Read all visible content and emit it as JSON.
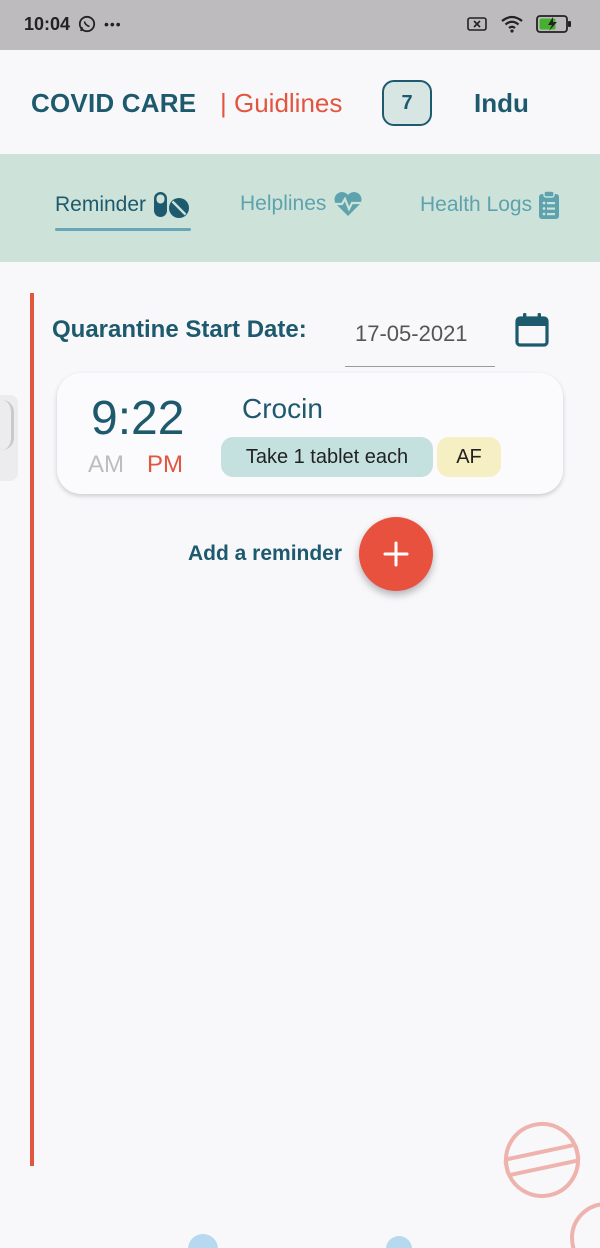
{
  "status_bar": {
    "time": "10:04",
    "dots": "•••",
    "icons": [
      "whatsapp-icon",
      "sim-off-icon",
      "wifi-icon",
      "battery-charging-icon"
    ]
  },
  "header": {
    "app_title": "COVID CARE",
    "guidelines_link": "| Guidlines",
    "badge_count": "7",
    "user_name": "Indu"
  },
  "tabs": [
    {
      "label": "Reminder",
      "icon": "pills-icon",
      "active": true
    },
    {
      "label": "Helplines",
      "icon": "heartbeat-icon",
      "active": false
    },
    {
      "label": "Health Logs",
      "icon": "clipboard-list-icon",
      "active": false
    }
  ],
  "quarantine": {
    "label": "Quarantine Start Date:",
    "date_value": "17-05-2021",
    "icon": "calendar-icon"
  },
  "reminders": [
    {
      "time": "9:22",
      "am_label": "AM",
      "pm_label": "PM",
      "selected_period": "PM",
      "medicine": "Crocin",
      "dosage": "Take 1 tablet each",
      "timing": "AF"
    }
  ],
  "add_reminder": {
    "label": "Add a reminder",
    "icon": "plus-icon"
  },
  "colors": {
    "primary": "#1d5a6e",
    "accent": "#e2553f",
    "tab_bar": "#cde3d9",
    "inactive_tab": "#5ea2ae",
    "dosage_chip": "#c5e1df",
    "timing_chip": "#f7efc4"
  }
}
